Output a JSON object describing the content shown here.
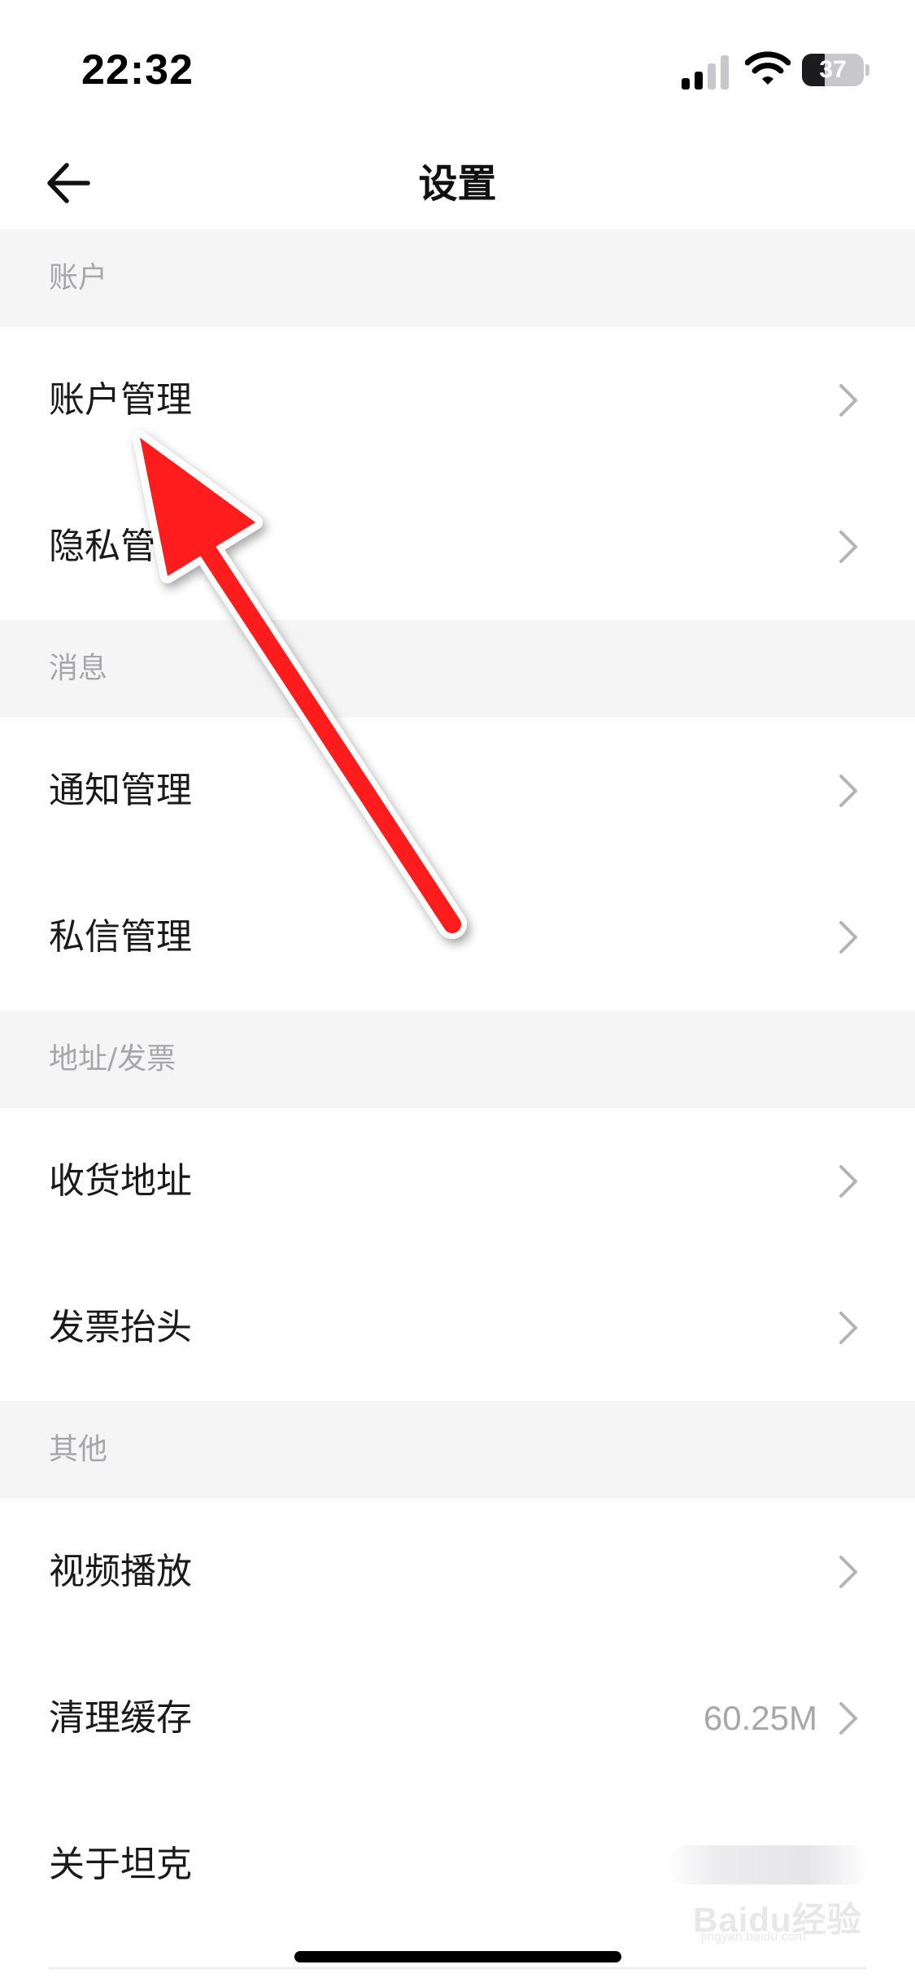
{
  "status_bar": {
    "time": "22:32",
    "battery": "37",
    "battery_level_percent": 37,
    "icons": [
      "signal-icon",
      "wifi-icon",
      "battery-icon"
    ]
  },
  "nav": {
    "title": "设置",
    "back_icon": "arrow-left-icon"
  },
  "sections": {
    "account": {
      "header": "账户",
      "items": [
        {
          "label": "账户管理"
        },
        {
          "label": "隐私管理"
        }
      ]
    },
    "message": {
      "header": "消息",
      "items": [
        {
          "label": "通知管理"
        },
        {
          "label": "私信管理"
        }
      ]
    },
    "address": {
      "header": "地址/发票",
      "items": [
        {
          "label": "收货地址"
        },
        {
          "label": "发票抬头"
        }
      ]
    },
    "other": {
      "header": "其他",
      "items": [
        {
          "label": "视频播放"
        },
        {
          "label": "清理缓存",
          "value": "60.25M"
        },
        {
          "label": "关于坦克"
        }
      ]
    }
  },
  "watermark": {
    "text": "Baidu经验",
    "sub": "jingyan.baidu.com"
  },
  "colors": {
    "section_bg": "#f5f5f6",
    "section_text": "#a6a6ab",
    "chevron": "#b3b3b8",
    "annotation_arrow": "#ff1a1a"
  }
}
